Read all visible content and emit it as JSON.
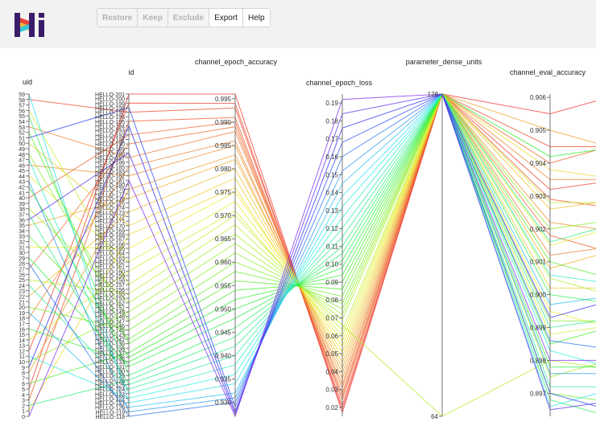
{
  "toolbar": {
    "restore": "Restore",
    "keep": "Keep",
    "exclude": "Exclude",
    "export": "Export",
    "help": "Help"
  },
  "colors": {
    "header_bg": "#f2f2f2",
    "logo_bg": "#3b1c6b",
    "axis": "#777777"
  },
  "chart_data": {
    "type": "parallel_coordinates",
    "title": "",
    "axes": [
      {
        "name": "uid",
        "label": "uid",
        "ticks": [
          "0",
          "1",
          "2",
          "3",
          "4",
          "5",
          "6",
          "7",
          "8",
          "9",
          "10",
          "11",
          "12",
          "13",
          "14",
          "15",
          "16",
          "17",
          "18",
          "19",
          "20",
          "21",
          "22",
          "23",
          "24",
          "25",
          "26",
          "27",
          "28",
          "29",
          "30",
          "31",
          "32",
          "33",
          "34",
          "35",
          "36",
          "37",
          "38",
          "39",
          "40",
          "41",
          "42",
          "43",
          "44",
          "45",
          "46",
          "47",
          "48",
          "49",
          "50",
          "51",
          "52",
          "53",
          "54",
          "55",
          "56",
          "57",
          "58",
          "59"
        ]
      },
      {
        "name": "id",
        "label": "id",
        "ticks": [
          "HELLO-118",
          "HELLO-119",
          "HELLO-120",
          "HELLO-121",
          "HELLO-122",
          "HELLO-123",
          "HELLO-124",
          "HELLO-125",
          "HELLO-128",
          "HELLO-129",
          "HELLO-130",
          "HELLO-131",
          "HELLO-133",
          "HELLO-136",
          "HELLO-137",
          "HELLO-138",
          "HELLO-139",
          "HELLO-142",
          "HELLO-143",
          "HELLO-145",
          "HELLO-146",
          "HELLO-147",
          "HELLO-148",
          "HELLO-149",
          "HELLO-151",
          "HELLO-152",
          "HELLO-153",
          "HELLO-155",
          "HELLO-156",
          "HELLO-157",
          "HELLO-158",
          "HELLO-159",
          "HELLO-160",
          "HELLO-161",
          "HELLO-162",
          "HELLO-163",
          "HELLO-164",
          "HELLO-165",
          "HELLO-166",
          "HELLO-167",
          "HELLO-168",
          "HELLO-169",
          "HELLO-170",
          "HELLO-171",
          "HELLO-172",
          "HELLO-173",
          "HELLO-174",
          "HELLO-175",
          "HELLO-176",
          "HELLO-177",
          "HELLO-179",
          "HELLO-180",
          "HELLO-181",
          "HELLO-182",
          "HELLO-183",
          "HELLO-185",
          "HELLO-186",
          "HELLO-187",
          "HELLO-188",
          "HELLO-189",
          "HELLO-190",
          "HELLO-191",
          "HELLO-192",
          "HELLO-193",
          "HELLO-194",
          "HELLO-195",
          "HELLO-196",
          "HELLO-197",
          "HELLO-198",
          "HELLO-199",
          "HELLO-200",
          "HELLO-201"
        ]
      },
      {
        "name": "channel_epoch_accuracy",
        "label": "channel_epoch_accuracy",
        "range": [
          0.927,
          0.996
        ],
        "ticks": [
          "0.930",
          "0.935",
          "0.940",
          "0.945",
          "0.950",
          "0.955",
          "0.960",
          "0.965",
          "0.970",
          "0.975",
          "0.980",
          "0.985",
          "0.990",
          "0.995"
        ]
      },
      {
        "name": "channel_epoch_loss",
        "label": "channel_epoch_loss",
        "range": [
          0.015,
          0.195
        ],
        "ticks": [
          "0.02",
          "0.03",
          "0.04",
          "0.05",
          "0.06",
          "0.07",
          "0.08",
          "0.09",
          "0.10",
          "0.11",
          "0.12",
          "0.13",
          "0.14",
          "0.15",
          "0.16",
          "0.17",
          "0.18",
          "0.19"
        ]
      },
      {
        "name": "parameter_dense_units",
        "label": "parameter_dense_units",
        "range": [
          64,
          128
        ],
        "ticks": [
          "64",
          "128"
        ]
      },
      {
        "name": "channel_eval_accuracy",
        "label": "channel_eval_accuracy",
        "range": [
          0.8963,
          0.9061
        ],
        "ticks": [
          "0.897",
          "0.898",
          "0.899",
          "0.900",
          "0.901",
          "0.902",
          "0.903",
          "0.904",
          "0.905",
          "0.906"
        ]
      }
    ],
    "color_by": "channel_epoch_loss",
    "colormap": "red-orange-yellow-green-cyan-blue-purple (low to high loss)",
    "series": [
      {
        "uid": 5,
        "id": "HELLO-201",
        "channel_epoch_accuracy": 0.996,
        "channel_epoch_loss": 0.017,
        "parameter_dense_units": 128,
        "channel_eval_accuracy": 0.9055
      },
      {
        "uid": 12,
        "id": "HELLO-199",
        "channel_epoch_accuracy": 0.994,
        "channel_epoch_loss": 0.019,
        "parameter_dense_units": 128,
        "channel_eval_accuracy": 0.9032
      },
      {
        "uid": 58,
        "id": "HELLO-197",
        "channel_epoch_accuracy": 0.993,
        "channel_epoch_loss": 0.021,
        "parameter_dense_units": 128,
        "channel_eval_accuracy": 0.9045
      },
      {
        "uid": 3,
        "id": "HELLO-195",
        "channel_epoch_accuracy": 0.991,
        "channel_epoch_loss": 0.024,
        "parameter_dense_units": 128,
        "channel_eval_accuracy": 0.9029
      },
      {
        "uid": 40,
        "id": "HELLO-192",
        "channel_epoch_accuracy": 0.99,
        "channel_epoch_loss": 0.026,
        "parameter_dense_units": 128,
        "channel_eval_accuracy": 0.9018
      },
      {
        "uid": 27,
        "id": "HELLO-190",
        "channel_epoch_accuracy": 0.989,
        "channel_epoch_loss": 0.028,
        "parameter_dense_units": 128,
        "channel_eval_accuracy": 0.904
      },
      {
        "uid": 53,
        "id": "HELLO-187",
        "channel_epoch_accuracy": 0.988,
        "channel_epoch_loss": 0.031,
        "parameter_dense_units": 128,
        "channel_eval_accuracy": 0.9012
      },
      {
        "uid": 18,
        "id": "HELLO-185",
        "channel_epoch_accuracy": 0.986,
        "channel_epoch_loss": 0.033,
        "parameter_dense_units": 128,
        "channel_eval_accuracy": 0.9035
      },
      {
        "uid": 46,
        "id": "HELLO-182",
        "channel_epoch_accuracy": 0.985,
        "channel_epoch_loss": 0.036,
        "parameter_dense_units": 128,
        "channel_eval_accuracy": 0.9022
      },
      {
        "uid": 8,
        "id": "HELLO-179",
        "channel_epoch_accuracy": 0.983,
        "channel_epoch_loss": 0.039,
        "parameter_dense_units": 128,
        "channel_eval_accuracy": 0.905
      },
      {
        "uid": 35,
        "id": "HELLO-176",
        "channel_epoch_accuracy": 0.982,
        "channel_epoch_loss": 0.042,
        "parameter_dense_units": 128,
        "channel_eval_accuracy": 0.9008
      },
      {
        "uid": 22,
        "id": "HELLO-173",
        "channel_epoch_accuracy": 0.98,
        "channel_epoch_loss": 0.045,
        "parameter_dense_units": 128,
        "channel_eval_accuracy": 0.9026
      },
      {
        "uid": 50,
        "id": "HELLO-170",
        "channel_epoch_accuracy": 0.978,
        "channel_epoch_loss": 0.048,
        "parameter_dense_units": 128,
        "channel_eval_accuracy": 0.9002
      },
      {
        "uid": 1,
        "id": "HELLO-168",
        "channel_epoch_accuracy": 0.976,
        "channel_epoch_loss": 0.051,
        "parameter_dense_units": 128,
        "channel_eval_accuracy": 0.9038
      },
      {
        "uid": 31,
        "id": "HELLO-165",
        "channel_epoch_accuracy": 0.975,
        "channel_epoch_loss": 0.054,
        "parameter_dense_units": 128,
        "channel_eval_accuracy": 0.8995
      },
      {
        "uid": 44,
        "id": "HELLO-162",
        "channel_epoch_accuracy": 0.973,
        "channel_epoch_loss": 0.057,
        "parameter_dense_units": 128,
        "channel_eval_accuracy": 0.9015
      },
      {
        "uid": 14,
        "id": "HELLO-160",
        "channel_epoch_accuracy": 0.971,
        "channel_epoch_loss": 0.06,
        "parameter_dense_units": 128,
        "channel_eval_accuracy": 0.8988
      },
      {
        "uid": 56,
        "id": "HELLO-157",
        "channel_epoch_accuracy": 0.97,
        "channel_epoch_loss": 0.063,
        "parameter_dense_units": 128,
        "channel_eval_accuracy": 0.9028
      },
      {
        "uid": 25,
        "id": "HELLO-155",
        "channel_epoch_accuracy": 0.968,
        "channel_epoch_loss": 0.066,
        "parameter_dense_units": 64,
        "channel_eval_accuracy": 0.898
      },
      {
        "uid": 38,
        "id": "HELLO-152",
        "channel_epoch_accuracy": 0.966,
        "channel_epoch_loss": 0.069,
        "parameter_dense_units": 128,
        "channel_eval_accuracy": 0.9005
      },
      {
        "uid": 10,
        "id": "HELLO-149",
        "channel_epoch_accuracy": 0.964,
        "channel_epoch_loss": 0.072,
        "parameter_dense_units": 128,
        "channel_eval_accuracy": 0.8975
      },
      {
        "uid": 48,
        "id": "HELLO-147",
        "channel_epoch_accuracy": 0.962,
        "channel_epoch_loss": 0.075,
        "parameter_dense_units": 128,
        "channel_eval_accuracy": 0.902
      },
      {
        "uid": 20,
        "id": "HELLO-145",
        "channel_epoch_accuracy": 0.96,
        "channel_epoch_loss": 0.078,
        "parameter_dense_units": 128,
        "channel_eval_accuracy": 0.8992
      },
      {
        "uid": 33,
        "id": "HELLO-142",
        "channel_epoch_accuracy": 0.958,
        "channel_epoch_loss": 0.082,
        "parameter_dense_units": 128,
        "channel_eval_accuracy": 0.897
      },
      {
        "uid": 52,
        "id": "HELLO-139",
        "channel_epoch_accuracy": 0.956,
        "channel_epoch_loss": 0.086,
        "parameter_dense_units": 128,
        "channel_eval_accuracy": 0.901
      },
      {
        "uid": 6,
        "id": "HELLO-137",
        "channel_epoch_accuracy": 0.954,
        "channel_epoch_loss": 0.09,
        "parameter_dense_units": 128,
        "channel_eval_accuracy": 0.8985
      },
      {
        "uid": 42,
        "id": "HELLO-136",
        "channel_epoch_accuracy": 0.952,
        "channel_epoch_loss": 0.094,
        "parameter_dense_units": 128,
        "channel_eval_accuracy": 0.9042
      },
      {
        "uid": 16,
        "id": "HELLO-133",
        "channel_epoch_accuracy": 0.95,
        "channel_epoch_loss": 0.098,
        "parameter_dense_units": 128,
        "channel_eval_accuracy": 0.8978
      },
      {
        "uid": 29,
        "id": "HELLO-131",
        "channel_epoch_accuracy": 0.948,
        "channel_epoch_loss": 0.102,
        "parameter_dense_units": 128,
        "channel_eval_accuracy": 0.9
      },
      {
        "uid": 55,
        "id": "HELLO-129",
        "channel_epoch_accuracy": 0.946,
        "channel_epoch_loss": 0.106,
        "parameter_dense_units": 128,
        "channel_eval_accuracy": 0.8968
      },
      {
        "uid": 2,
        "id": "HELLO-128",
        "channel_epoch_accuracy": 0.944,
        "channel_epoch_loss": 0.11,
        "parameter_dense_units": 128,
        "channel_eval_accuracy": 0.9016
      },
      {
        "uid": 37,
        "id": "HELLO-125",
        "channel_epoch_accuracy": 0.942,
        "channel_epoch_loss": 0.115,
        "parameter_dense_units": 128,
        "channel_eval_accuracy": 0.899
      },
      {
        "uid": 24,
        "id": "HELLO-124",
        "channel_epoch_accuracy": 0.94,
        "channel_epoch_loss": 0.12,
        "parameter_dense_units": 128,
        "channel_eval_accuracy": 0.8972
      },
      {
        "uid": 47,
        "id": "HELLO-123",
        "channel_epoch_accuracy": 0.938,
        "channel_epoch_loss": 0.126,
        "parameter_dense_units": 128,
        "channel_eval_accuracy": 0.9006
      },
      {
        "uid": 11,
        "id": "HELLO-122",
        "channel_epoch_accuracy": 0.936,
        "channel_epoch_loss": 0.132,
        "parameter_dense_units": 128,
        "channel_eval_accuracy": 0.8983
      },
      {
        "uid": 59,
        "id": "HELLO-121",
        "channel_epoch_accuracy": 0.934,
        "channel_epoch_loss": 0.138,
        "parameter_dense_units": 128,
        "channel_eval_accuracy": 0.8966
      },
      {
        "uid": 19,
        "id": "HELLO-120",
        "channel_epoch_accuracy": 0.932,
        "channel_epoch_loss": 0.145,
        "parameter_dense_units": 128,
        "channel_eval_accuracy": 0.8997
      },
      {
        "uid": 43,
        "id": "HELLO-119",
        "channel_epoch_accuracy": 0.931,
        "channel_epoch_loss": 0.152,
        "parameter_dense_units": 128,
        "channel_eval_accuracy": 0.8976
      },
      {
        "uid": 28,
        "id": "HELLO-118",
        "channel_epoch_accuracy": 0.93,
        "channel_epoch_loss": 0.16,
        "parameter_dense_units": 128,
        "channel_eval_accuracy": 0.8986
      },
      {
        "uid": 51,
        "id": "HELLO-198",
        "channel_epoch_accuracy": 0.929,
        "channel_epoch_loss": 0.168,
        "parameter_dense_units": 128,
        "channel_eval_accuracy": 0.897
      },
      {
        "uid": 9,
        "id": "HELLO-194",
        "channel_epoch_accuracy": 0.928,
        "channel_epoch_loss": 0.176,
        "parameter_dense_units": 128,
        "channel_eval_accuracy": 0.8993
      },
      {
        "uid": 36,
        "id": "HELLO-188",
        "channel_epoch_accuracy": 0.9275,
        "channel_epoch_loss": 0.184,
        "parameter_dense_units": 128,
        "channel_eval_accuracy": 0.8965
      },
      {
        "uid": 0,
        "id": "HELLO-181",
        "channel_epoch_accuracy": 0.927,
        "channel_epoch_loss": 0.192,
        "parameter_dense_units": 128,
        "channel_eval_accuracy": 0.898
      }
    ]
  }
}
